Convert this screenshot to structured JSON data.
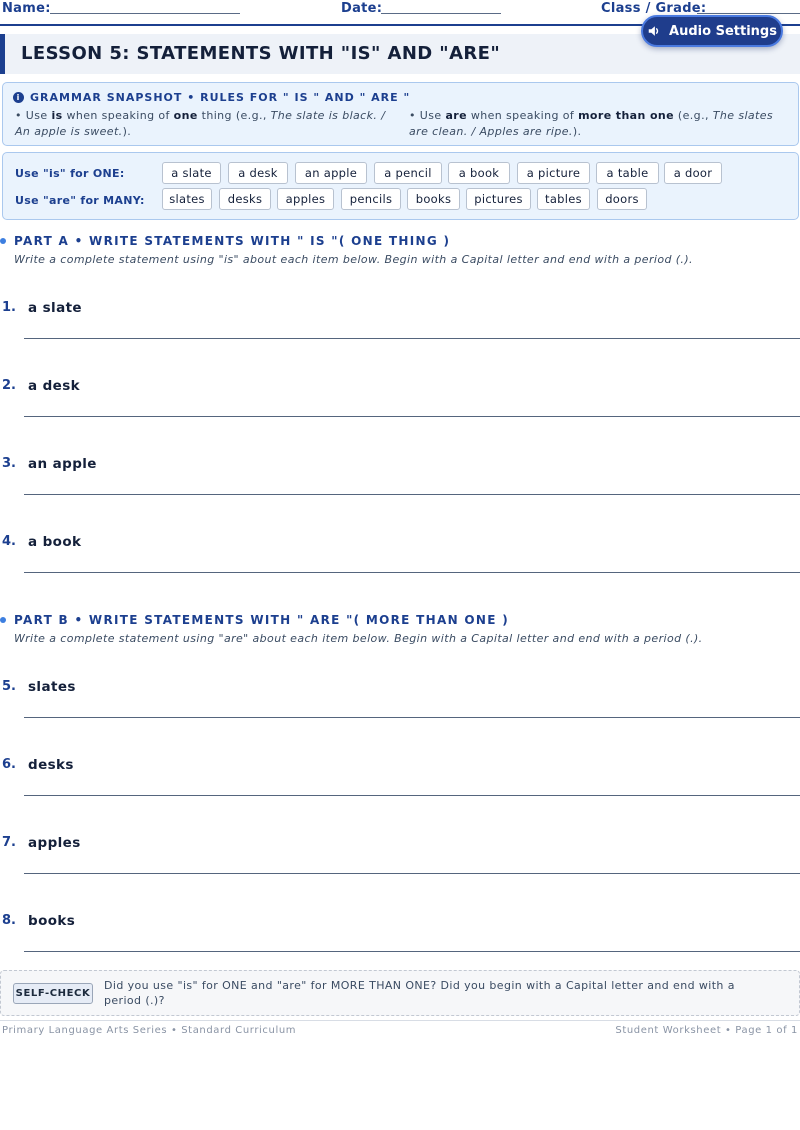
{
  "header": {
    "name_label": "Name:",
    "date_label": "Date:",
    "class_label": "Class / Grade:",
    "audio_button": "Audio Settings"
  },
  "title": "LESSON 5: STATEMENTS WITH \"IS\" AND \"ARE\"",
  "snapshot": {
    "heading": "GRAMMAR SNAPSHOT • RULES FOR \" IS \" AND \" ARE \"",
    "rule_is": {
      "prefix": "• Use ",
      "keyword": "is",
      "middle": " when speaking of ",
      "keyword2": "one",
      "suffix": " thing (e.g., ",
      "example": "The slate is black. / An apple is sweet.",
      "end": ")."
    },
    "rule_are": {
      "prefix": "• Use ",
      "keyword": "are",
      "middle": " when speaking of ",
      "keyword2": "more than one",
      "suffix": " (e.g., ",
      "example": "The slates are clean. / Apples are ripe.",
      "end": ")."
    }
  },
  "wordbank": {
    "is_label": "Use \"is\" for ONE:",
    "are_label": "Use \"are\" for MANY:",
    "singular": [
      "a slate",
      "a desk",
      "an apple",
      "a pencil",
      "a book",
      "a picture",
      "a table",
      "a door"
    ],
    "plural": [
      "slates",
      "desks",
      "apples",
      "pencils",
      "books",
      "pictures",
      "tables",
      "doors"
    ]
  },
  "part_a": {
    "heading": "PART A • WRITE STATEMENTS WITH \" IS \"( ONE THING )",
    "instruction": "Write a complete statement using \"is\" about each item below. Begin with a Capital letter and end with a period (.).",
    "items": [
      {
        "num": "1.",
        "word": "a slate"
      },
      {
        "num": "2.",
        "word": "a desk"
      },
      {
        "num": "3.",
        "word": "an apple"
      },
      {
        "num": "4.",
        "word": "a book"
      }
    ]
  },
  "part_b": {
    "heading": "PART B • WRITE STATEMENTS WITH \" ARE \"( MORE THAN ONE )",
    "instruction": "Write a complete statement using \"are\" about each item below. Begin with a Capital letter and end with a period (.).",
    "items": [
      {
        "num": "5.",
        "word": "slates"
      },
      {
        "num": "6.",
        "word": "desks"
      },
      {
        "num": "7.",
        "word": "apples"
      },
      {
        "num": "8.",
        "word": "books"
      }
    ]
  },
  "self_check": {
    "badge": "SELF-CHECK",
    "text": "Did you use \"is\" for ONE and \"are\" for MORE THAN ONE? Did you begin with a Capital letter and end with a period (.)?"
  },
  "footer": {
    "left": "Primary Language Arts Series • Standard Curriculum",
    "right": "Student Worksheet • Page 1 of 1"
  },
  "colors": {
    "accent": "#1c3f8f",
    "panel": "#eaf3fd",
    "button": "#1f3d8c"
  }
}
